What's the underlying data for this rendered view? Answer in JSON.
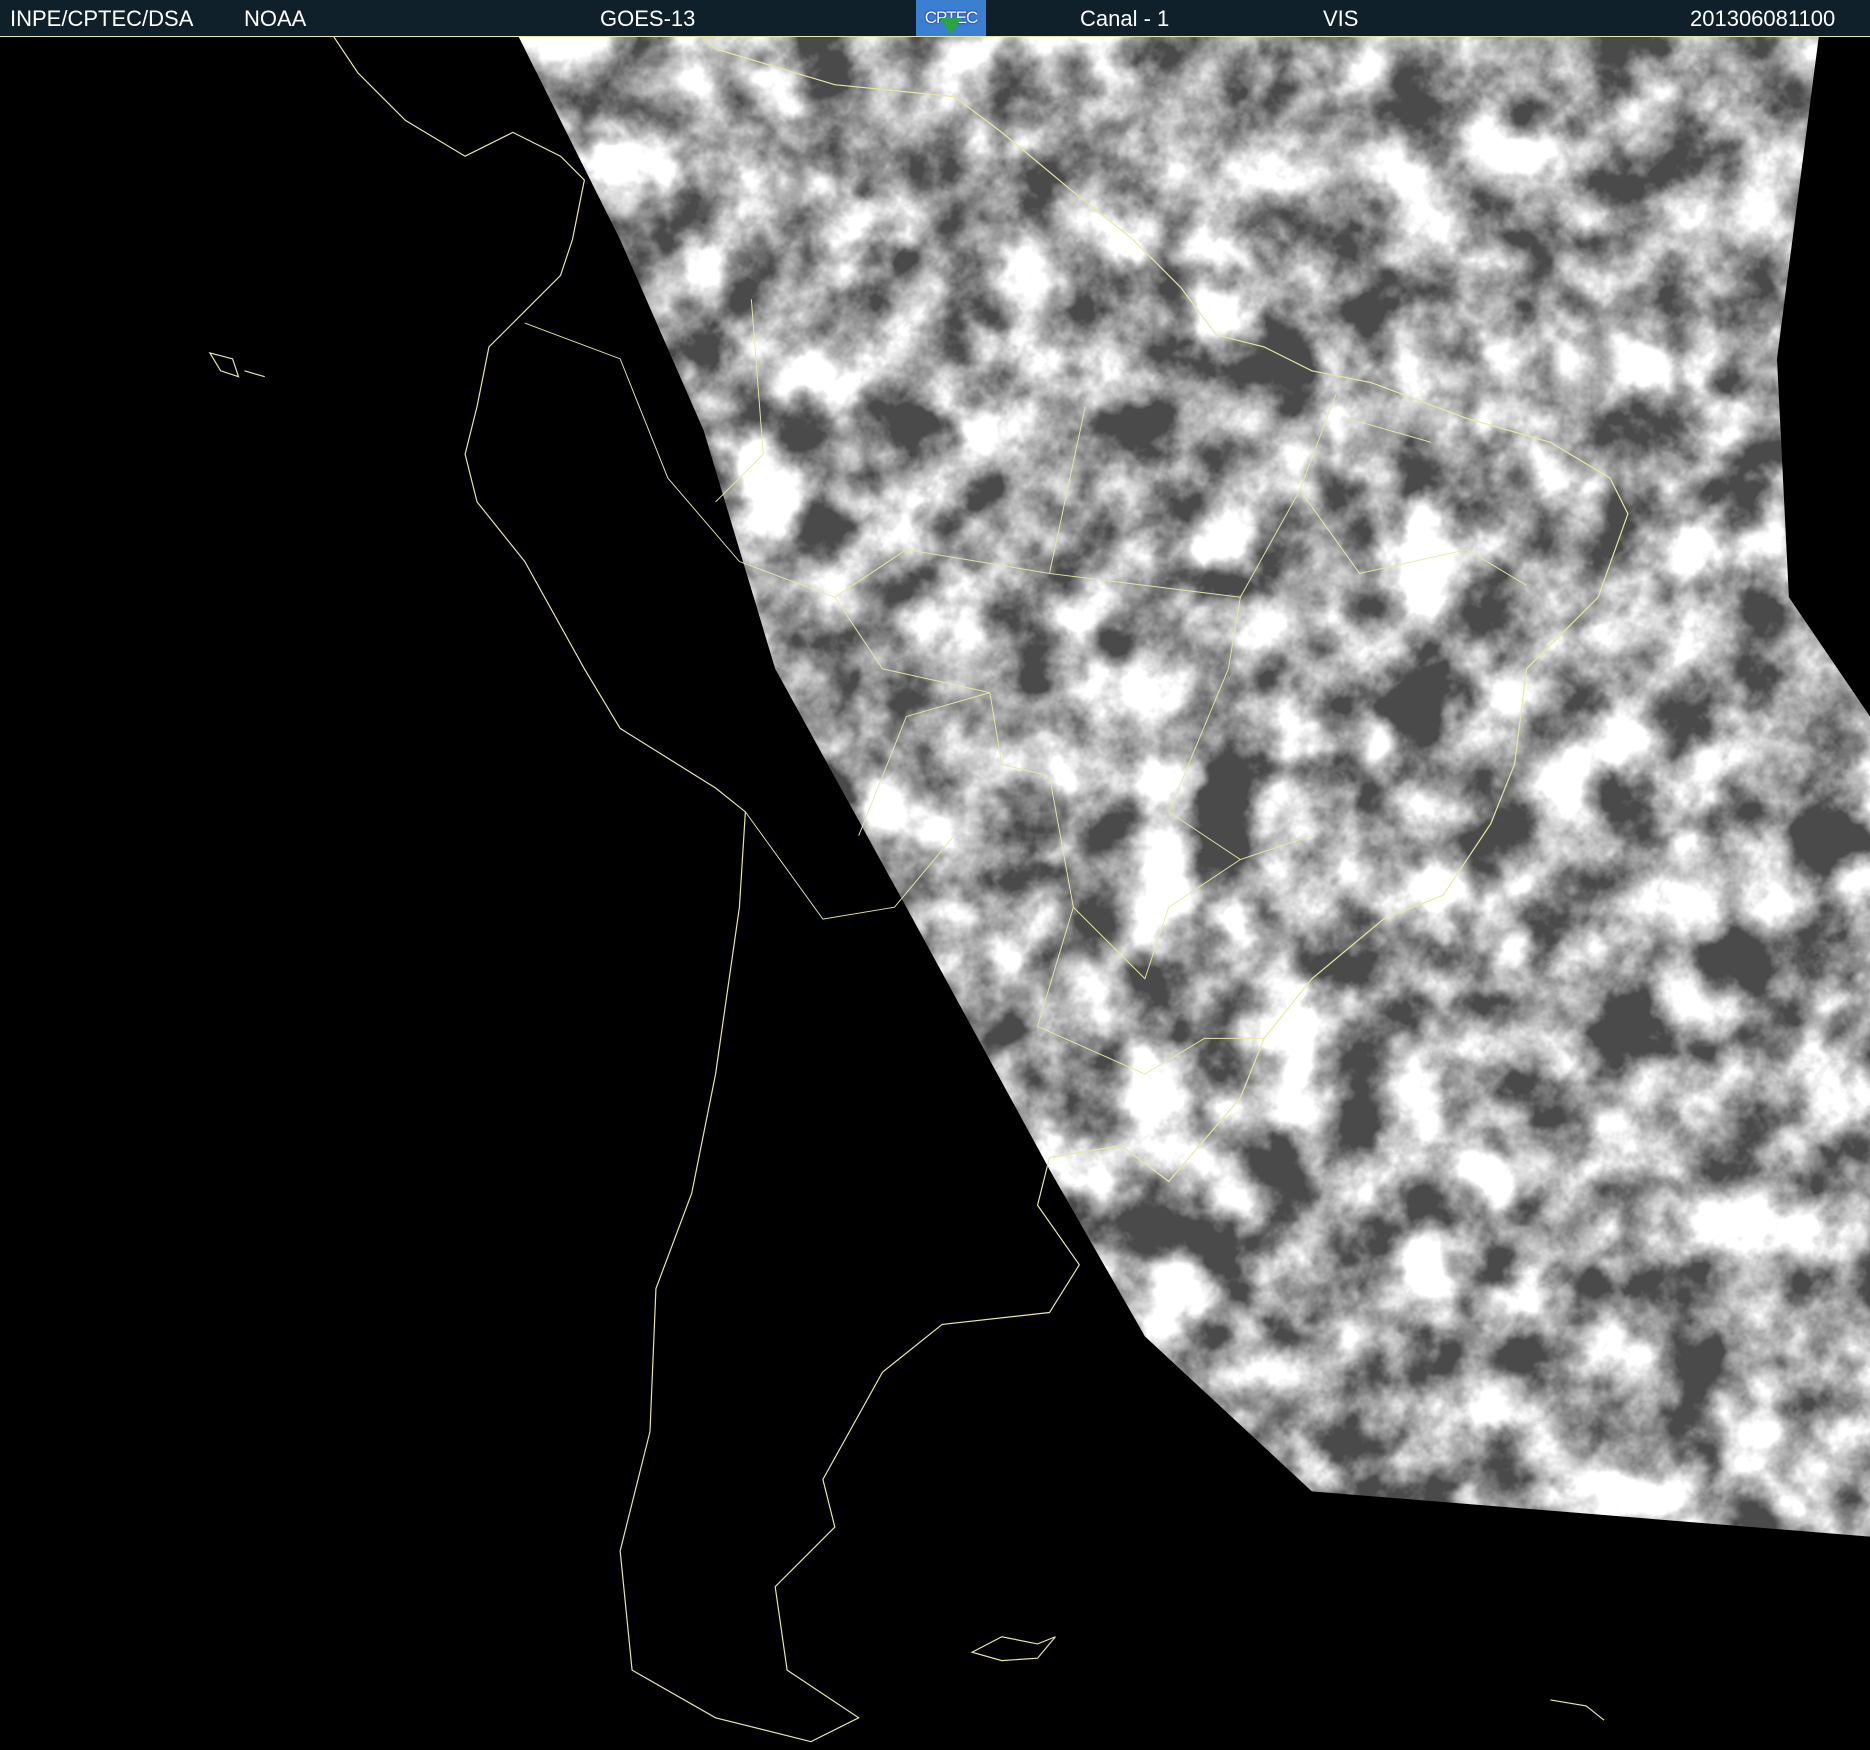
{
  "header": {
    "agency": "INPE/CPTEC/DSA",
    "source": "NOAA",
    "satellite": "GOES-13",
    "logo_text": "CPTEC",
    "channel": "Canal - 1",
    "band": "VIS",
    "timestamp": "201306081100"
  },
  "colors": {
    "header_bg": "#10202a",
    "coastline": "#e8e8a0",
    "background": "#000000"
  }
}
